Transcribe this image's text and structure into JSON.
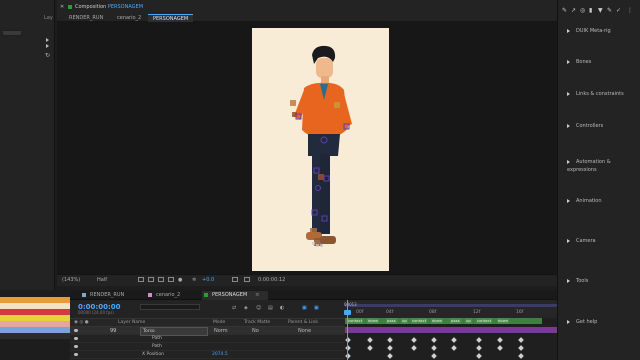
{
  "left_panel": {
    "label": "Lay"
  },
  "composition": {
    "prefix": "Composition",
    "name": "PERSONAGEM",
    "tabs": [
      {
        "label": "RENDER_RUN"
      },
      {
        "label": "cenario_2"
      },
      {
        "label": "PERSONAGEM"
      }
    ]
  },
  "viewer_bar": {
    "zoom": "(143%)",
    "resolution": "Half",
    "exposure": "+0.0",
    "time": "0:00:00:12"
  },
  "right_panel": {
    "items": [
      {
        "label": "DUIK Meta-rig"
      },
      {
        "label": "Bones"
      },
      {
        "label": "Links & constraints"
      },
      {
        "label": "Controllers"
      },
      {
        "label": "Automation & expressions"
      },
      {
        "label": "Animation"
      },
      {
        "label": "Camera"
      },
      {
        "label": "Tools"
      },
      {
        "label": "Get help"
      }
    ]
  },
  "timeline": {
    "tabs": [
      {
        "label": "RENDER_RUN",
        "color": "#7ea7d8"
      },
      {
        "label": "cenario_2",
        "color": "#d88ad0"
      },
      {
        "label": "PERSONAGEM",
        "color": "#2aa02a"
      }
    ],
    "timecode": "0:00:00:00",
    "timecode_sub": "00000 (24.00 fps)",
    "columns": {
      "layer_name": "Layer Name",
      "mode": "Mode",
      "track_matte": "Track Matte",
      "parent": "Parent & Link"
    },
    "layers": [
      {
        "num": "99",
        "name": "Torso",
        "mode": "Norm",
        "matte": "No",
        "parent": "None"
      },
      {
        "num": "",
        "name": "Path",
        "mode": "",
        "matte": "",
        "parent": ""
      },
      {
        "num": "",
        "name": "Path",
        "mode": "",
        "matte": "",
        "parent": ""
      },
      {
        "num": "",
        "name": "X Position",
        "value": "2074.5",
        "mode": "",
        "matte": "",
        "parent": ""
      }
    ],
    "ruler": [
      "00f",
      "04f",
      "08f",
      "12f",
      "16f"
    ],
    "work_start": "00013",
    "markers": [
      "contact",
      "down",
      "pass",
      "up",
      "contact",
      "down",
      "pass",
      "up",
      "contact",
      "down"
    ]
  },
  "colors": {
    "accent": "#4aa7ff",
    "canvas": "#f8ecd6",
    "marker": "#4b8a4b",
    "track": "#7a3a92"
  }
}
